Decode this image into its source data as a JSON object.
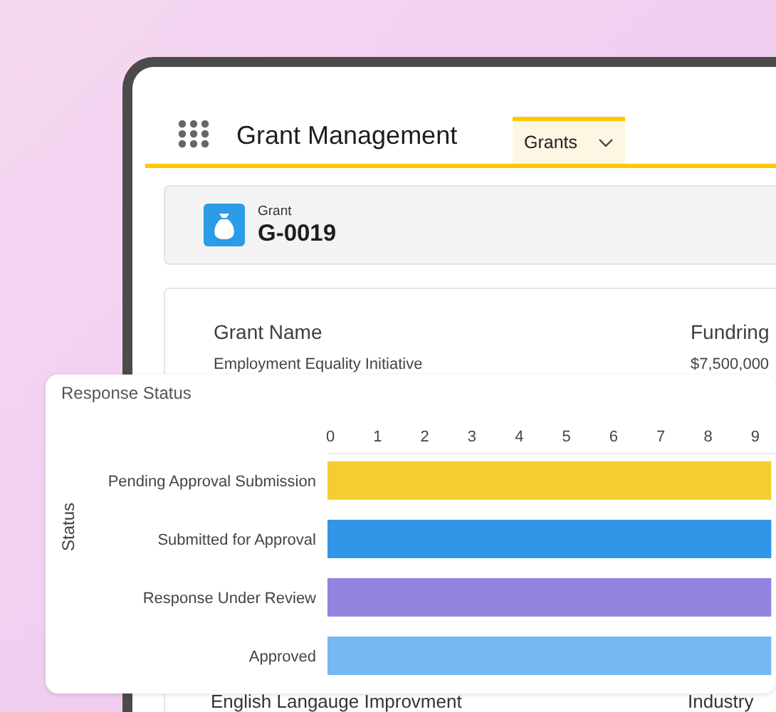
{
  "app_name": "Grant Management",
  "nav_tabs": [
    {
      "label": "Grants",
      "selected": true
    }
  ],
  "record": {
    "object_label": "Grant",
    "name": "G-0019"
  },
  "details": {
    "columns": [
      "Grant Name",
      "Fundring"
    ],
    "rows": [
      [
        "Employment Equality Initiative",
        "$7,500,000"
      ],
      [
        "English Langauge Improvment",
        "Industry"
      ]
    ]
  },
  "response_status": {
    "title": "Response Status",
    "chart_data": {
      "type": "bar",
      "orientation": "horizontal",
      "ylabel": "Status",
      "categories": [
        "Pending Approval Submission",
        "Submitted for Approval",
        "Response Under Review",
        "Approved"
      ],
      "series": [
        {
          "color": "#f4ce30",
          "values": [
            9.4,
            null,
            null,
            null
          ]
        },
        {
          "color": "#3196e8",
          "values": [
            null,
            9.4,
            null,
            null
          ]
        },
        {
          "color": "#9384e0",
          "values": [
            null,
            null,
            9.4,
            null
          ]
        },
        {
          "color": "#76b8f2",
          "values": [
            null,
            null,
            null,
            9.4
          ]
        }
      ],
      "xlim": [
        0,
        9.5
      ],
      "xticks": [
        0,
        1,
        2,
        3,
        4,
        5,
        6,
        7,
        8,
        9
      ]
    }
  }
}
